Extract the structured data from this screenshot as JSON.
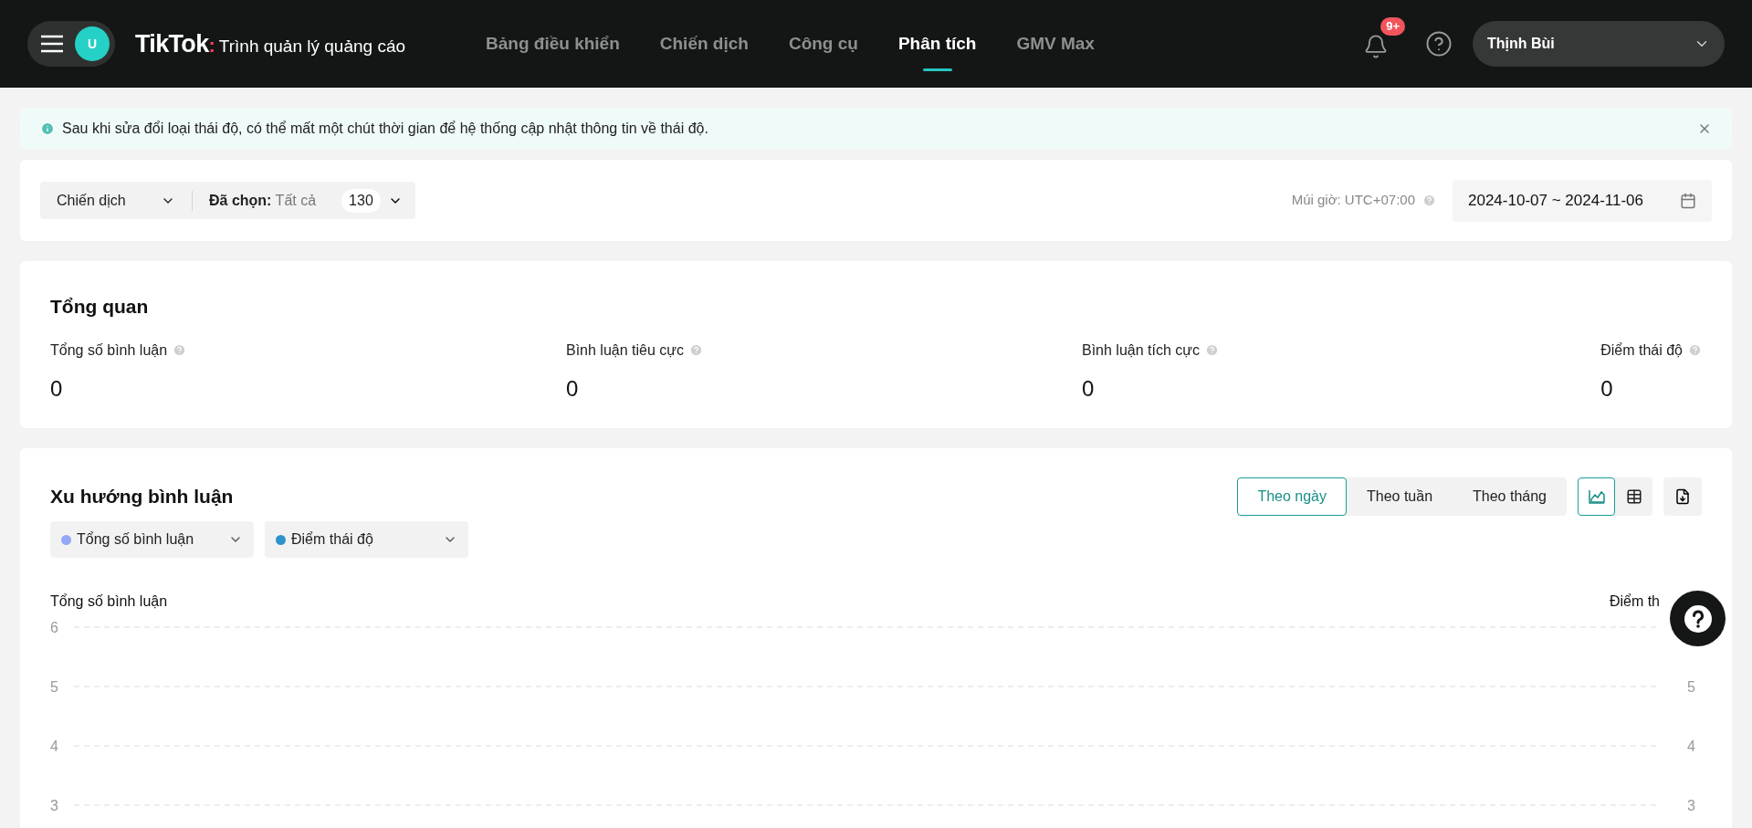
{
  "header": {
    "avatar_initial": "U",
    "logo": "TikTok",
    "logo_dot": ":",
    "product": "Trình quản lý quảng cáo",
    "nav": [
      {
        "label": "Bảng điều khiển",
        "selected": false
      },
      {
        "label": "Chiến dịch",
        "selected": false
      },
      {
        "label": "Công cụ",
        "selected": false
      },
      {
        "label": "Phân tích",
        "selected": true
      },
      {
        "label": "GMV Max",
        "selected": false
      }
    ],
    "notification_badge": "9+",
    "account": "Thịnh Bùi"
  },
  "notice": {
    "text": "Sau khi sửa đổi loại thái độ, có thể mất một chút thời gian để hệ thống cập nhật thông tin về thái độ."
  },
  "filters": {
    "level": "Chiến dịch",
    "selected_label": "Đã chọn:",
    "selected_value": "Tất cả",
    "count": "130",
    "timezone": "Múi giờ: UTC+07:00",
    "date_range": "2024-10-07 ~ 2024-11-06"
  },
  "overview": {
    "title": "Tổng quan",
    "metrics": [
      {
        "label": "Tổng số bình luận",
        "value": "0"
      },
      {
        "label": "Bình luận tiêu cực",
        "value": "0"
      },
      {
        "label": "Bình luận tích cực",
        "value": "0"
      },
      {
        "label": "Điểm thái độ",
        "value": "0"
      }
    ]
  },
  "trend": {
    "title": "Xu hướng bình luận",
    "periods": [
      {
        "label": "Theo ngày",
        "selected": true
      },
      {
        "label": "Theo tuần",
        "selected": false
      },
      {
        "label": "Theo tháng",
        "selected": false
      }
    ],
    "views": [
      {
        "kind": "chart",
        "selected": true
      },
      {
        "kind": "table",
        "selected": false
      }
    ],
    "metric_selects": [
      {
        "label": "Tổng số bình luận",
        "color": "#94a8f7"
      },
      {
        "label": "Điểm thái độ",
        "color": "#2e93cc"
      }
    ],
    "left_axis": {
      "label": "Tổng số bình luận",
      "ticks": [
        "6",
        "5",
        "4",
        "3"
      ]
    },
    "right_axis": {
      "label": "Điểm th",
      "ticks": [
        "5",
        "4",
        "3"
      ]
    }
  }
}
